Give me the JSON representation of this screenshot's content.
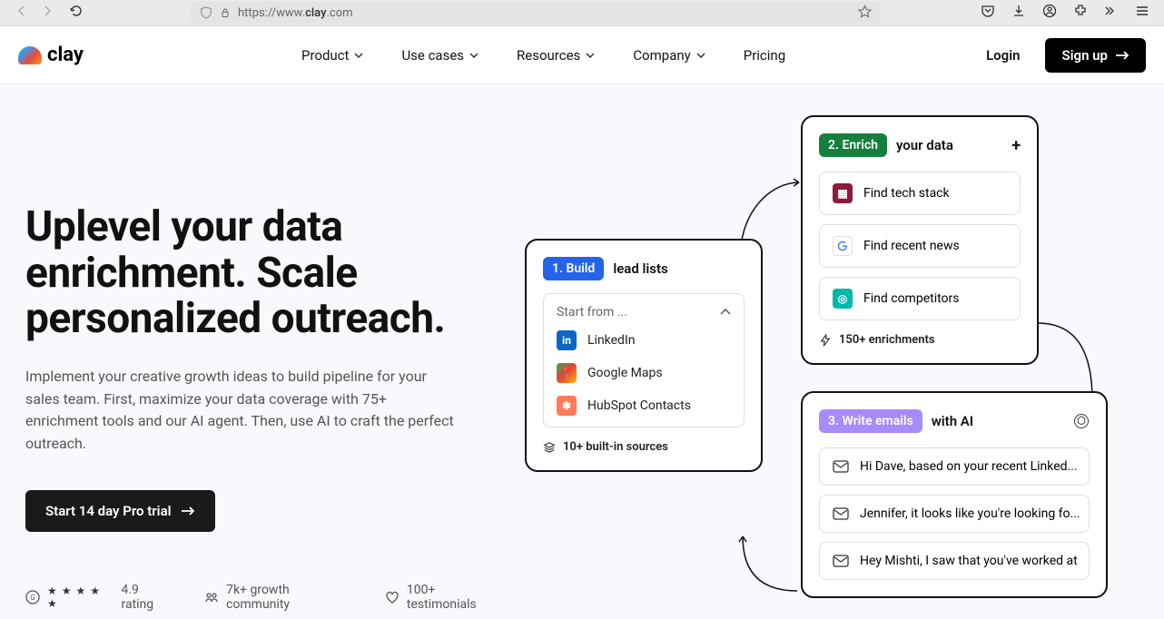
{
  "browser": {
    "url_prefix": "https://www.",
    "url_domain": "clay",
    "url_suffix": ".com"
  },
  "header": {
    "logo_text": "clay",
    "nav": [
      "Product",
      "Use cases",
      "Resources",
      "Company",
      "Pricing"
    ],
    "login": "Login",
    "signup": "Sign up"
  },
  "hero": {
    "title": "Uplevel your data enrichment. Scale personalized outreach.",
    "subtitle": "Implement your creative growth ideas to build pipeline for your sales team. First, maximize your data coverage with 75+ enrichment tools and our AI agent. Then, use AI to craft the perfect outreach.",
    "cta": "Start 14 day Pro trial",
    "proof": {
      "rating": "4.9 rating",
      "community": "7k+ growth community",
      "testimonials": "100+ testimonials"
    }
  },
  "cards": {
    "build": {
      "badge": "1. Build",
      "suffix": "lead lists",
      "dropdown_label": "Start from ...",
      "sources": [
        "LinkedIn",
        "Google Maps",
        "HubSpot Contacts"
      ],
      "footer": "10+ built-in sources"
    },
    "enrich": {
      "badge": "2. Enrich",
      "suffix": "your data",
      "items": [
        "Find tech stack",
        "Find recent news",
        "Find competitors"
      ],
      "footer": "150+ enrichments"
    },
    "emails": {
      "badge": "3. Write emails",
      "suffix": "with AI",
      "items": [
        "Hi Dave, based on your recent Linked...",
        "Jennifer, it looks like you're looking fo...",
        "Hey Mishti, I saw that you've worked at"
      ]
    }
  }
}
